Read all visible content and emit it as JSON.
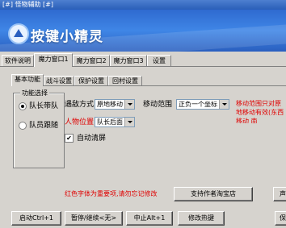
{
  "window": {
    "title": "[#] 怪物辅助 [#]"
  },
  "banner": {
    "app_name": "按键小精灵"
  },
  "main_tabs": [
    "软件说明",
    "魔力窗口1",
    "魔力窗口2",
    "魔力窗口3",
    "设置"
  ],
  "sub_tabs": [
    "基本功能",
    "战斗设置",
    "保护设置",
    "回村设置"
  ],
  "function_group": {
    "legend": "功能选择",
    "options": [
      {
        "label": "队长带队",
        "selected": true
      },
      {
        "label": "队员跟随",
        "selected": false
      }
    ]
  },
  "settings": {
    "encounter_label": "遇敌方式",
    "encounter_value": "原地移动",
    "range_label": "移动范围",
    "range_value": "正负一个坐标",
    "range_note": "移动范围只对原地移动有效(东西移动 南",
    "person_label": "人物位置",
    "person_value": "队长后面",
    "auto_clean_label": "自动清屏",
    "auto_clean_checked": true
  },
  "red_note": "红色字体为重要项,请勿忘记修改",
  "buttons": {
    "support": "支持作者淘宝店",
    "right_clipped": "声",
    "start": "启动Ctrl+1",
    "pause": "暂停/继续<无>",
    "stop": "中止Alt+1",
    "hotkey": "修改热键",
    "far_right": "保"
  },
  "colors": {
    "banner": "#3f86e6",
    "important_text": "#e00000"
  }
}
